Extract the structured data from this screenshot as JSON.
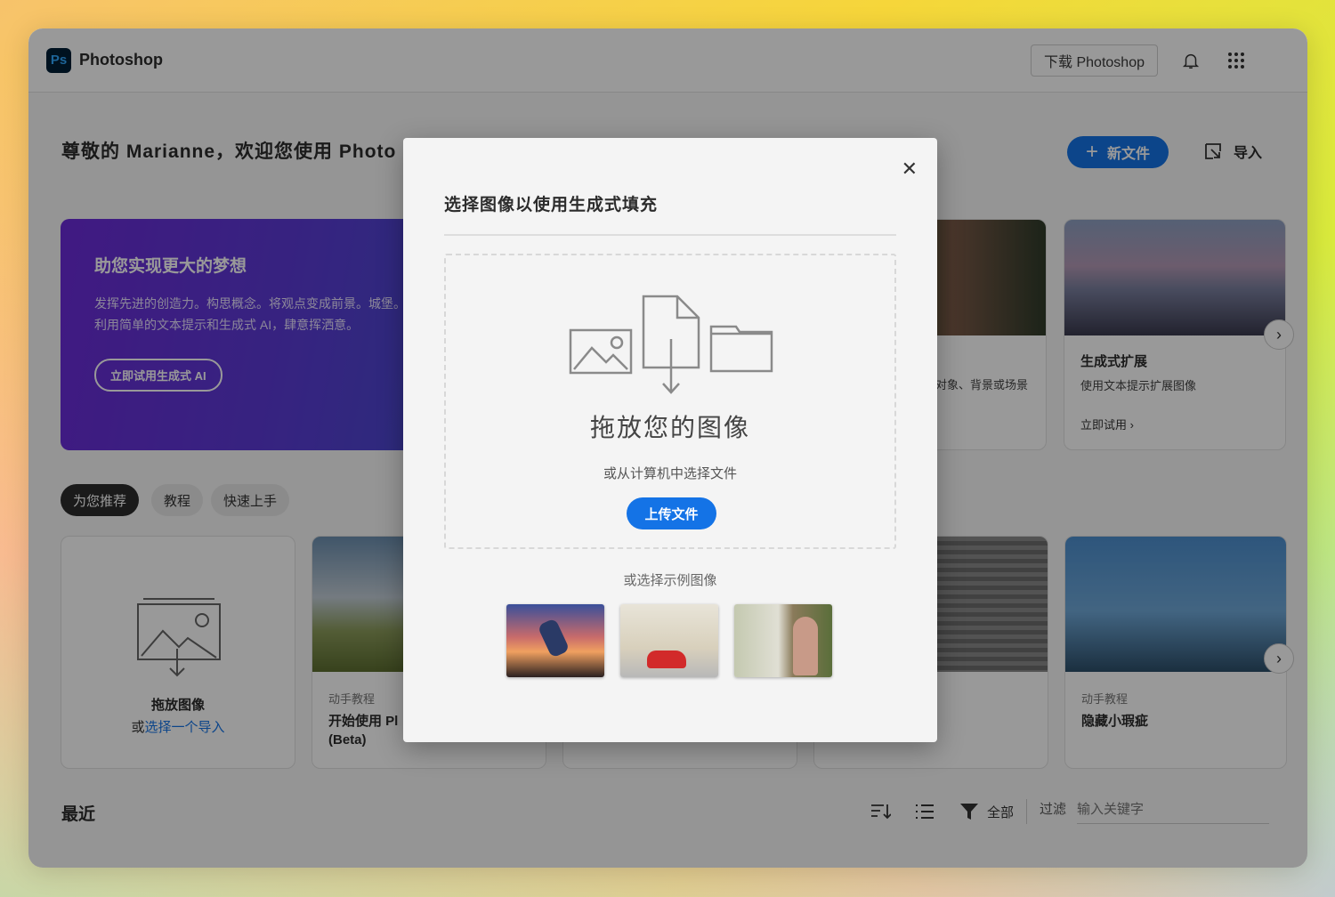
{
  "app": {
    "logo_text": "Ps",
    "name": "Photoshop"
  },
  "header": {
    "download_label": "下载 Photoshop",
    "bell_icon": "bell-icon",
    "apps_icon": "app-grid-icon"
  },
  "greeting": "尊敬的 Marianne，欢迎您使用 Photo",
  "actions": {
    "new_file": "新文件",
    "import": "导入"
  },
  "promo": {
    "title": "助您实现更大的梦想",
    "body": "发挥先进的创造力。构思概念。将观点变成前景。城堡。利用简单的文本提示和生成式 AI，肆意挥洒意。",
    "button": "立即试用生成式 AI"
  },
  "feature_cards": [
    {
      "desc": "对象、背景或场景"
    },
    {
      "title": "生成式扩展",
      "desc": "使用文本提示扩展图像",
      "link": "立即试用 ›"
    }
  ],
  "chips": [
    "为您推荐",
    "教程",
    "快速上手"
  ],
  "drop_card": {
    "title": "拖放图像",
    "prefix": "或",
    "link": "选择一个导入"
  },
  "tutorial_cards": [
    {
      "tag": "动手教程",
      "title_line1": "开始使用 Pl",
      "title_line2": "(Beta)"
    },
    {
      "tag": "动手教程",
      "title_line1": "隐藏小瑕疵"
    }
  ],
  "recent": {
    "title": "最近",
    "filter_all": "全部",
    "filter_label": "过滤",
    "filter_placeholder": "输入关键字"
  },
  "modal": {
    "title": "选择图像以使用生成式填充",
    "drop_title": "拖放您的图像",
    "drop_sub": "或从计算机中选择文件",
    "upload": "上传文件",
    "samples_label": "或选择示例图像",
    "close_icon": "close-icon"
  },
  "colors": {
    "accent": "#1473e6",
    "promo": "#6c2bd9"
  }
}
